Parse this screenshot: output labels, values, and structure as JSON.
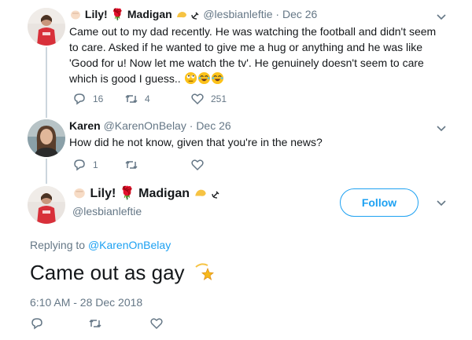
{
  "colors": {
    "accent": "#1da1f2",
    "muted": "#657786",
    "text": "#14171a",
    "line": "#ccd6dd"
  },
  "tweet1": {
    "name": "Lily! 🌹 Madigan",
    "handle": "@lesbianleftie",
    "date": "Dec 26",
    "text": "Came out to my dad recently. He was watching the football and didn't seem to care. Asked if he wanted to give me a hug or anything and he was like 'Good for u! Now let me watch the tv'. He genuinely doesn't seem to care which is good I guess..",
    "replies": "16",
    "retweets": "4",
    "likes": "251"
  },
  "tweet2": {
    "name": "Karen",
    "handle": "@KarenOnBelay",
    "date": "Dec 26",
    "text": "How did he not know, given that you're in the news?",
    "replies": "1"
  },
  "main": {
    "name": "Lily! 🌹 Madigan",
    "handle": "@lesbianleftie",
    "follow_label": "Follow",
    "replying_prefix": "Replying to",
    "replying_handle": "@KarenOnBelay",
    "text": "Came out as gay",
    "timestamp": "6:10 AM - 28 Dec 2018"
  },
  "icons": [
    "reply-icon",
    "retweet-icon",
    "like-icon",
    "chevron-down-icon",
    "dizzy-star-emoji",
    "flexed-arm-emoji",
    "hammer-sickle-icon"
  ]
}
